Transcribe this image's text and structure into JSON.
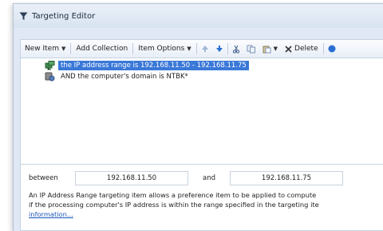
{
  "window": {
    "title": "Targeting Editor"
  },
  "toolbar": {
    "new_item": "New Item",
    "add_collection": "Add Collection",
    "item_options": "Item Options",
    "delete": "Delete"
  },
  "tree": {
    "items": [
      {
        "text": "the IP address range is 192.168.11.50 - 192.168.11.75",
        "selected": true,
        "icon": "network-icon"
      },
      {
        "text": "AND the computer's domain is NTBK*",
        "selected": false,
        "icon": "domain-icon"
      }
    ]
  },
  "details": {
    "between_label": "between",
    "start_ip": "192.168.11.50",
    "and_label": "and",
    "end_ip": "192.168.11.75",
    "description_line1": "An IP Address Range targeting item allows a preference item to be applied to compute",
    "description_line2": "if the processing computer's IP address is within the range specified in the targeting ite",
    "more_link": "information..."
  },
  "colors": {
    "selection": "#3a78d8",
    "link": "#1b55b8",
    "window_bg": "#dfe8f4"
  }
}
